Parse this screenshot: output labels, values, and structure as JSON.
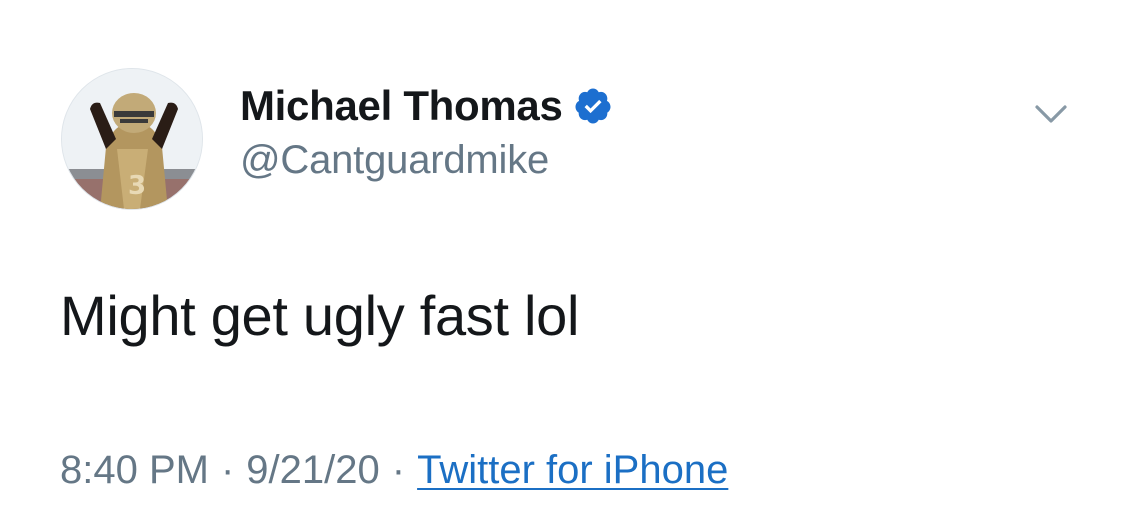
{
  "user": {
    "display_name": "Michael Thomas",
    "handle": "@Cantguardmike",
    "verified": true
  },
  "tweet": {
    "text": "Might get ugly fast lol",
    "time": "8:40 PM",
    "date": "9/21/20",
    "separator": "·",
    "source": "Twitter for iPhone"
  },
  "icons": {
    "verified": "verified-badge-icon",
    "menu": "chevron-down-icon"
  },
  "colors": {
    "verified_blue": "#1d9bf0",
    "link_blue": "#1b6fc4",
    "meta_gray": "#657786",
    "text_black": "#14171a"
  }
}
